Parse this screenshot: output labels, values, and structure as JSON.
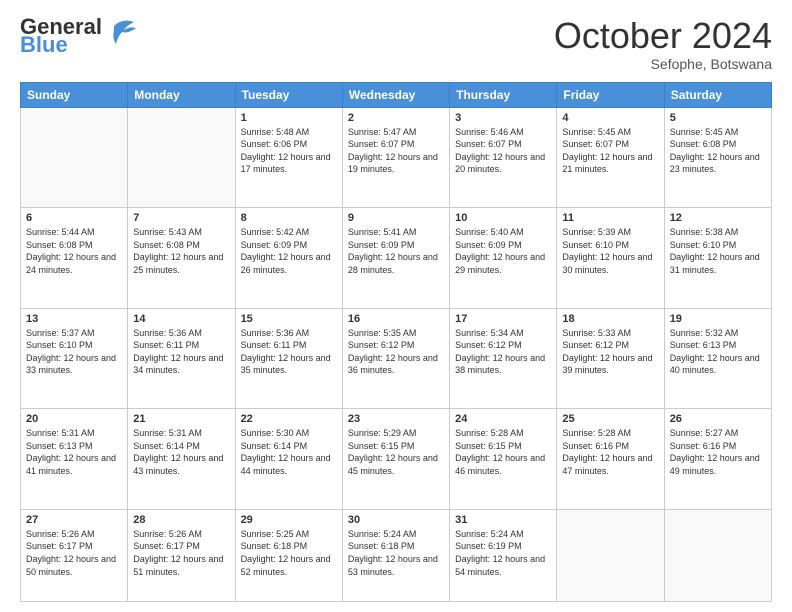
{
  "header": {
    "logo_general": "General",
    "logo_blue": "Blue",
    "month_title": "October 2024",
    "subtitle": "Sefophe, Botswana"
  },
  "weekdays": [
    "Sunday",
    "Monday",
    "Tuesday",
    "Wednesday",
    "Thursday",
    "Friday",
    "Saturday"
  ],
  "weeks": [
    [
      {
        "day": "",
        "info": ""
      },
      {
        "day": "",
        "info": ""
      },
      {
        "day": "1",
        "info": "Sunrise: 5:48 AM\nSunset: 6:06 PM\nDaylight: 12 hours and 17 minutes."
      },
      {
        "day": "2",
        "info": "Sunrise: 5:47 AM\nSunset: 6:07 PM\nDaylight: 12 hours and 19 minutes."
      },
      {
        "day": "3",
        "info": "Sunrise: 5:46 AM\nSunset: 6:07 PM\nDaylight: 12 hours and 20 minutes."
      },
      {
        "day": "4",
        "info": "Sunrise: 5:45 AM\nSunset: 6:07 PM\nDaylight: 12 hours and 21 minutes."
      },
      {
        "day": "5",
        "info": "Sunrise: 5:45 AM\nSunset: 6:08 PM\nDaylight: 12 hours and 23 minutes."
      }
    ],
    [
      {
        "day": "6",
        "info": "Sunrise: 5:44 AM\nSunset: 6:08 PM\nDaylight: 12 hours and 24 minutes."
      },
      {
        "day": "7",
        "info": "Sunrise: 5:43 AM\nSunset: 6:08 PM\nDaylight: 12 hours and 25 minutes."
      },
      {
        "day": "8",
        "info": "Sunrise: 5:42 AM\nSunset: 6:09 PM\nDaylight: 12 hours and 26 minutes."
      },
      {
        "day": "9",
        "info": "Sunrise: 5:41 AM\nSunset: 6:09 PM\nDaylight: 12 hours and 28 minutes."
      },
      {
        "day": "10",
        "info": "Sunrise: 5:40 AM\nSunset: 6:09 PM\nDaylight: 12 hours and 29 minutes."
      },
      {
        "day": "11",
        "info": "Sunrise: 5:39 AM\nSunset: 6:10 PM\nDaylight: 12 hours and 30 minutes."
      },
      {
        "day": "12",
        "info": "Sunrise: 5:38 AM\nSunset: 6:10 PM\nDaylight: 12 hours and 31 minutes."
      }
    ],
    [
      {
        "day": "13",
        "info": "Sunrise: 5:37 AM\nSunset: 6:10 PM\nDaylight: 12 hours and 33 minutes."
      },
      {
        "day": "14",
        "info": "Sunrise: 5:36 AM\nSunset: 6:11 PM\nDaylight: 12 hours and 34 minutes."
      },
      {
        "day": "15",
        "info": "Sunrise: 5:36 AM\nSunset: 6:11 PM\nDaylight: 12 hours and 35 minutes."
      },
      {
        "day": "16",
        "info": "Sunrise: 5:35 AM\nSunset: 6:12 PM\nDaylight: 12 hours and 36 minutes."
      },
      {
        "day": "17",
        "info": "Sunrise: 5:34 AM\nSunset: 6:12 PM\nDaylight: 12 hours and 38 minutes."
      },
      {
        "day": "18",
        "info": "Sunrise: 5:33 AM\nSunset: 6:12 PM\nDaylight: 12 hours and 39 minutes."
      },
      {
        "day": "19",
        "info": "Sunrise: 5:32 AM\nSunset: 6:13 PM\nDaylight: 12 hours and 40 minutes."
      }
    ],
    [
      {
        "day": "20",
        "info": "Sunrise: 5:31 AM\nSunset: 6:13 PM\nDaylight: 12 hours and 41 minutes."
      },
      {
        "day": "21",
        "info": "Sunrise: 5:31 AM\nSunset: 6:14 PM\nDaylight: 12 hours and 43 minutes."
      },
      {
        "day": "22",
        "info": "Sunrise: 5:30 AM\nSunset: 6:14 PM\nDaylight: 12 hours and 44 minutes."
      },
      {
        "day": "23",
        "info": "Sunrise: 5:29 AM\nSunset: 6:15 PM\nDaylight: 12 hours and 45 minutes."
      },
      {
        "day": "24",
        "info": "Sunrise: 5:28 AM\nSunset: 6:15 PM\nDaylight: 12 hours and 46 minutes."
      },
      {
        "day": "25",
        "info": "Sunrise: 5:28 AM\nSunset: 6:16 PM\nDaylight: 12 hours and 47 minutes."
      },
      {
        "day": "26",
        "info": "Sunrise: 5:27 AM\nSunset: 6:16 PM\nDaylight: 12 hours and 49 minutes."
      }
    ],
    [
      {
        "day": "27",
        "info": "Sunrise: 5:26 AM\nSunset: 6:17 PM\nDaylight: 12 hours and 50 minutes."
      },
      {
        "day": "28",
        "info": "Sunrise: 5:26 AM\nSunset: 6:17 PM\nDaylight: 12 hours and 51 minutes."
      },
      {
        "day": "29",
        "info": "Sunrise: 5:25 AM\nSunset: 6:18 PM\nDaylight: 12 hours and 52 minutes."
      },
      {
        "day": "30",
        "info": "Sunrise: 5:24 AM\nSunset: 6:18 PM\nDaylight: 12 hours and 53 minutes."
      },
      {
        "day": "31",
        "info": "Sunrise: 5:24 AM\nSunset: 6:19 PM\nDaylight: 12 hours and 54 minutes."
      },
      {
        "day": "",
        "info": ""
      },
      {
        "day": "",
        "info": ""
      }
    ]
  ]
}
